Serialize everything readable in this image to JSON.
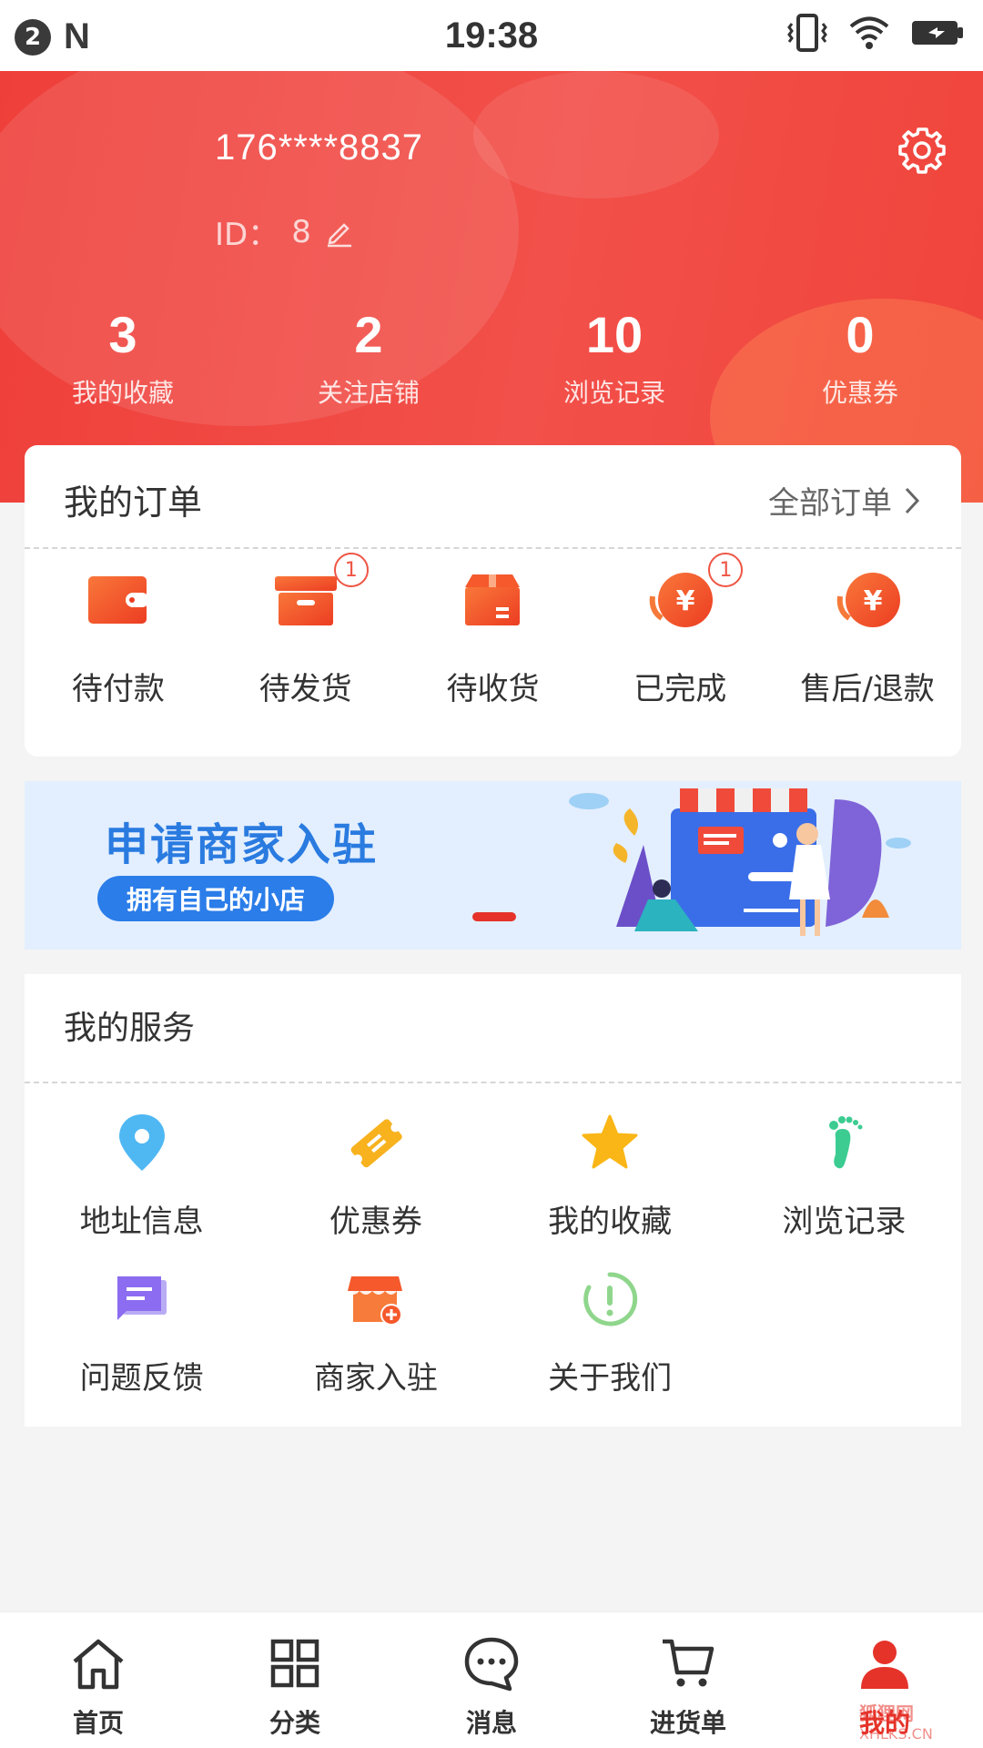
{
  "status_bar": {
    "notification_count": "2",
    "app_letter": "N",
    "time": "19:38"
  },
  "profile": {
    "phone": "176****8837",
    "id_label": "ID：",
    "id_value": "8"
  },
  "stats": [
    {
      "value": "3",
      "label": "我的收藏"
    },
    {
      "value": "2",
      "label": "关注店铺"
    },
    {
      "value": "10",
      "label": "浏览记录"
    },
    {
      "value": "0",
      "label": "优惠券"
    }
  ],
  "orders": {
    "title": "我的订单",
    "all_label": "全部订单",
    "items": [
      {
        "label": "待付款",
        "icon": "wallet-icon",
        "badge": ""
      },
      {
        "label": "待发货",
        "icon": "box-icon",
        "badge": "1"
      },
      {
        "label": "待收货",
        "icon": "package-icon",
        "badge": ""
      },
      {
        "label": "已完成",
        "icon": "yuan-coin-icon",
        "badge": "1"
      },
      {
        "label": "售后/退款",
        "icon": "refund-coin-icon",
        "badge": ""
      }
    ]
  },
  "banner": {
    "title": "申请商家入驻",
    "subtitle": "拥有自己的小店"
  },
  "services": {
    "title": "我的服务",
    "items": [
      {
        "label": "地址信息",
        "icon": "location-pin-icon"
      },
      {
        "label": "优惠券",
        "icon": "ticket-icon"
      },
      {
        "label": "我的收藏",
        "icon": "star-icon"
      },
      {
        "label": "浏览记录",
        "icon": "footprint-icon"
      },
      {
        "label": "问题反馈",
        "icon": "feedback-icon"
      },
      {
        "label": "商家入驻",
        "icon": "store-add-icon"
      },
      {
        "label": "关于我们",
        "icon": "info-icon"
      }
    ]
  },
  "bottom_nav": [
    {
      "label": "首页",
      "icon": "home-icon"
    },
    {
      "label": "分类",
      "icon": "grid-icon"
    },
    {
      "label": "消息",
      "icon": "chat-icon"
    },
    {
      "label": "进货单",
      "icon": "cart-icon"
    },
    {
      "label": "我的",
      "icon": "user-icon"
    }
  ],
  "watermark": {
    "line1": "狐狸网",
    "line2": "XHLKS.CN"
  },
  "colors": {
    "primary": "#e5332a",
    "header": "#ef3f3a",
    "banner_blue": "#2b7de9",
    "orange": "#f5592c"
  }
}
